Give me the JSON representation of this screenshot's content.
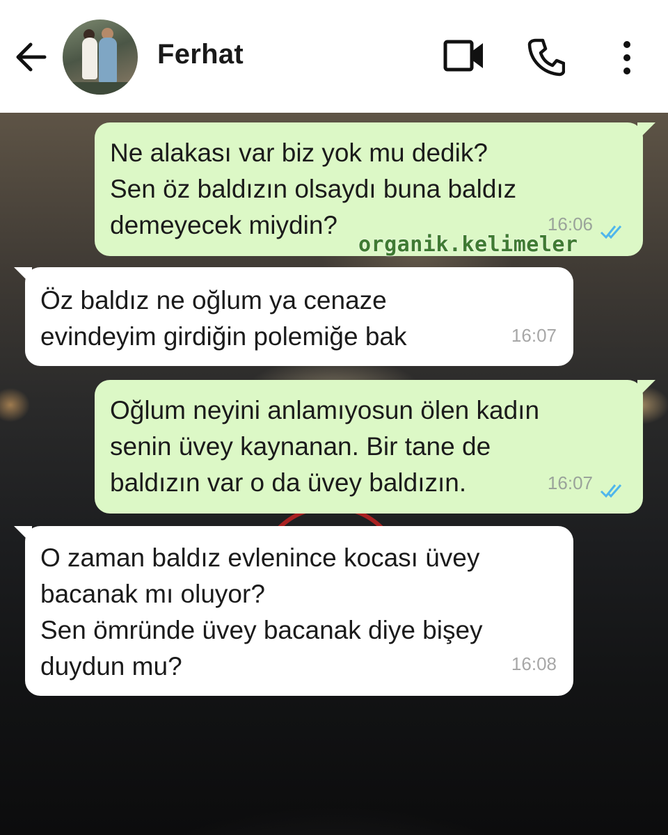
{
  "header": {
    "back_icon": "arrow-left-icon",
    "contact_name": "Ferhat",
    "video_icon": "video-camera-icon",
    "call_icon": "phone-icon",
    "more_icon": "more-vertical-icon"
  },
  "messages": [
    {
      "direction": "outgoing",
      "lines": [
        "Ne alakası var biz yok mu dedik?",
        "Sen öz baldızın olsaydı buna baldız",
        "demeyecek miydin?"
      ],
      "time": "16:06",
      "status": "read"
    },
    {
      "direction": "incoming",
      "lines": [
        "Öz baldız ne oğlum ya cenaze",
        "evindeyim girdiğin polemiğe bak"
      ],
      "time": "16:07"
    },
    {
      "direction": "outgoing",
      "lines": [
        "Oğlum neyini anlamıyosun ölen kadın",
        "senin üvey kaynanan. Bir tane de",
        "baldızın var o da üvey baldızın."
      ],
      "time": "16:07",
      "status": "read"
    },
    {
      "direction": "incoming",
      "lines": [
        "O zaman baldız evlenince kocası üvey",
        "bacanak mı oluyor?",
        "Sen ömründe üvey bacanak diye bişey",
        "duydun mu?"
      ],
      "time": "16:08"
    }
  ],
  "watermark": "organik.kelimeler",
  "colors": {
    "outgoing_bubble": "#dcf8c6",
    "incoming_bubble": "#ffffff",
    "read_ticks": "#4fb6ec",
    "header_bg": "#ffffff"
  }
}
